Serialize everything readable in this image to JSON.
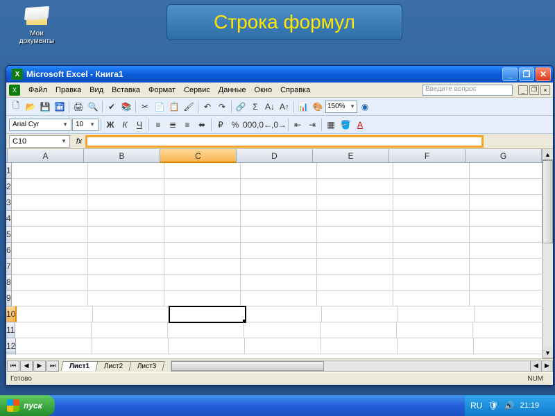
{
  "desktop": {
    "mydocs_label": "Мои\nдокументы"
  },
  "callout": {
    "text": "Строка формул"
  },
  "window": {
    "title": "Microsoft Excel - Книга1",
    "ask_placeholder": "Введите вопрос"
  },
  "menu": {
    "items": [
      "Файл",
      "Правка",
      "Вид",
      "Вставка",
      "Формат",
      "Сервис",
      "Данные",
      "Окно",
      "Справка"
    ]
  },
  "toolbar_std": {
    "zoom": "150%"
  },
  "toolbar_fmt": {
    "font": "Arial Cyr",
    "size": "10"
  },
  "formula_bar": {
    "name_box": "C10",
    "fx_label": "fx",
    "formula_value": ""
  },
  "grid": {
    "columns": [
      "A",
      "B",
      "C",
      "D",
      "E",
      "F",
      "G"
    ],
    "rows": [
      "1",
      "2",
      "3",
      "4",
      "5",
      "6",
      "7",
      "8",
      "9",
      "10",
      "11",
      "12"
    ],
    "active_cell": "C10",
    "selected_col": "C",
    "selected_row": "10"
  },
  "sheets": {
    "tabs": [
      "Лист1",
      "Лист2",
      "Лист3"
    ],
    "active": "Лист1"
  },
  "status": {
    "ready": "Готово",
    "num": "NUM"
  },
  "taskbar": {
    "start": "пуск",
    "lang": "RU",
    "clock": "21:19"
  }
}
